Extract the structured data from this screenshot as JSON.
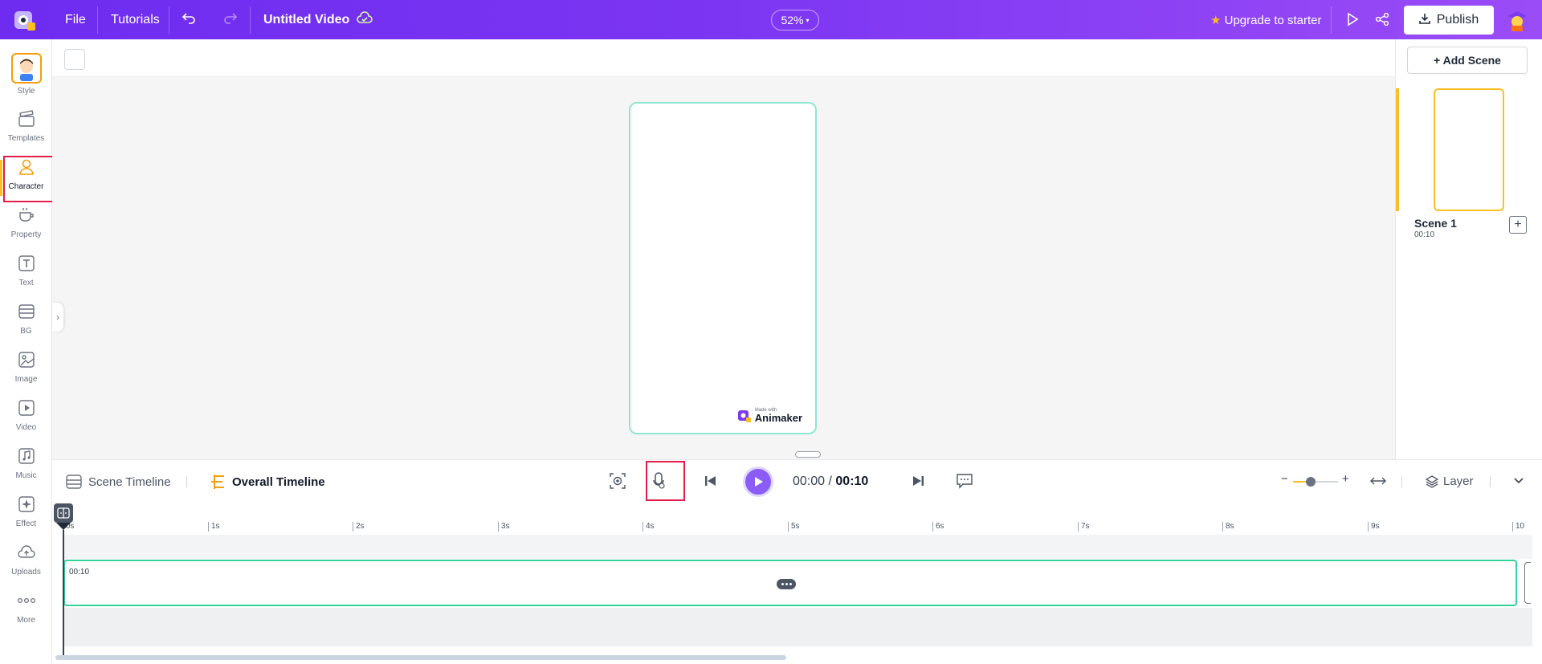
{
  "topbar": {
    "file": "File",
    "tutorials": "Tutorials",
    "title": "Untitled Video",
    "zoom": "52%",
    "upgrade": "Upgrade to starter",
    "publish": "Publish"
  },
  "sidebar": {
    "items": [
      {
        "label": "Style",
        "icon": "style-avatar-icon"
      },
      {
        "label": "Templates",
        "icon": "templates-icon"
      },
      {
        "label": "Character",
        "icon": "character-icon"
      },
      {
        "label": "Property",
        "icon": "property-cup-icon"
      },
      {
        "label": "Text",
        "icon": "text-icon"
      },
      {
        "label": "BG",
        "icon": "bg-layers-icon"
      },
      {
        "label": "Image",
        "icon": "image-icon"
      },
      {
        "label": "Video",
        "icon": "video-icon"
      },
      {
        "label": "Music",
        "icon": "music-icon"
      },
      {
        "label": "Effect",
        "icon": "effect-icon"
      },
      {
        "label": "Uploads",
        "icon": "upload-cloud-icon"
      },
      {
        "label": "More",
        "icon": "more-dots-icon"
      }
    ],
    "active": "Character"
  },
  "canvas": {
    "watermark_small": "Made with",
    "watermark_brand": "Animaker"
  },
  "scenes": {
    "add_scene": "+ Add Scene",
    "items": [
      {
        "name": "Scene 1",
        "duration": "00:10"
      }
    ]
  },
  "timeline": {
    "scene_tab": "Scene Timeline",
    "overall_tab": "Overall Timeline",
    "current_time": "00:00",
    "separator": "/",
    "total_time": "00:10",
    "layer": "Layer",
    "ruler": [
      "0s",
      "1s",
      "2s",
      "3s",
      "4s",
      "5s",
      "6s",
      "7s",
      "8s",
      "9s",
      "10"
    ],
    "block_time": "00:10",
    "zoom_level": 0.4
  },
  "colors": {
    "accent": "#7b35f2",
    "highlight": "#fbbf24",
    "play": "#8b5cf6",
    "scene_block": "#34d399",
    "annotation": "#e11d48"
  }
}
